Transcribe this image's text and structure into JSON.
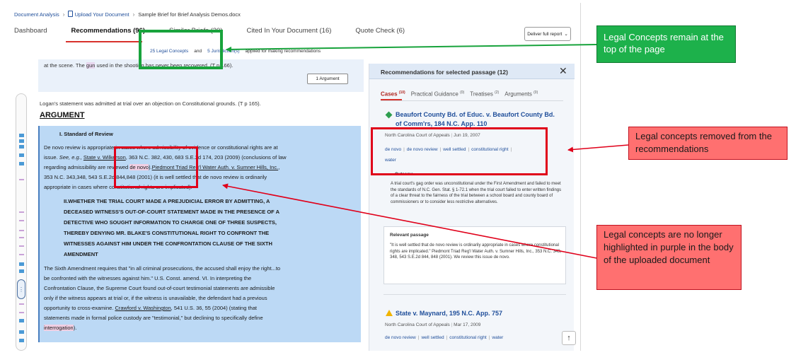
{
  "breadcrumb": {
    "item1": "Document Analysis",
    "item2": "Upload Your Document",
    "item3": "Sample Brief for Brief Analysis Demos.docx"
  },
  "tabs": [
    {
      "label": "Dashboard"
    },
    {
      "label": "Recommendations  (96)"
    },
    {
      "label": "Similar Briefs  (20)"
    },
    {
      "label": "Cited In Your Document  (16)"
    },
    {
      "label": "Quote Check  (6)"
    }
  ],
  "toolbar": {
    "deliver_label": "Deliver full report"
  },
  "applied": {
    "concepts_link": "25 Legal Concepts",
    "and": "and",
    "jurisdictions_link": "5 Jurisdiction(s)",
    "suffix": "applied for making recommendations"
  },
  "document": {
    "preview_line_a": "at the scene. The ",
    "preview_hl": "gun",
    "preview_line_b": " used in the shooting has never been recovered. (T p 166).",
    "argument_button": "1 Argument",
    "statement_line": "Logan's statement was admitted at trial over an objection on Constitutional grounds. (T p 165).",
    "argument_heading": "ARGUMENT",
    "standard_heading": "I. Standard of Review",
    "p1_l1": "De novo review is appropriate in cases where admissibility of evidence or constitutional rights are at",
    "p1_l2a": "issue. ",
    "p1_l2b": "See, e.g.,",
    "p1_l2c": "State v. Wilkerson",
    "p1_l2d": ", 363 N.C. 382, 430, 683 S.E.2d 174, 203 (2009) (conclusions of law",
    "p1_l3a": "regarding admissibility are reviewed ",
    "p1_l3b": "de novo",
    "p1_l3c": ").",
    "p1_l3d": "Piedmont Triad Reg'l Water Auth. v. Sumner Hills, Inc.",
    "p1_l3e": ",",
    "p1_l4": "353 N.C. 343,348, 543 S.E.2d 844,848 (2001) (it is well settled that de novo review is ordinarily",
    "p1_l5": "appropriate in cases where constitutional rights are implicated).",
    "h2_l1": "II.WHETHER THE TRIAL COURT MADE A PREJUDICIAL ERROR BY ADMITTING, A",
    "h2_l2": "DECEASED WITNESS'S OUT-OF-COURT STATEMENT MADE IN THE PRESENCE OF A",
    "h2_l3": "DETECTIVE WHO SOUGHT INFORMATION TO CHARGE ONE OF THREE SUSPECTS,",
    "h2_l4": "THEREBY DENYING MR. BLAKE'S CONSTITUTIONAL RIGHT TO CONFRONT THE",
    "h2_l5": "WITNESSES AGAINST HIM UNDER THE CONFRONTATION CLAUSE OF THE SIXTH",
    "h2_l6": "AMENDMENT",
    "p2_l1": "The Sixth Amendment requires that \"in all criminal prosecutions, the accused shall enjoy the right...to",
    "p2_l2": "be confronted with the witnesses against him.\" U.S. Const. amend. VI. In interpreting the",
    "p2_l3": "Confrontation Clause, the Supreme Court found out-of-court testimonial statements are admissible",
    "p2_l4": "only if the witness appears at trial or, if the witness is unavailable, the defendant had a previous",
    "p2_l5a": "opportunity to cross-examine. ",
    "p2_l5b": "Crawford v. Washington",
    "p2_l5c": ", 541 U.S. 36, 55 (2004) (stating that",
    "p2_l6": "statements made in formal police custody are \"testimonial,\" but declining to specifically define",
    "p2_l7a": "interrogation",
    "p2_l7b": ")."
  },
  "panel": {
    "title": "Recommendations for selected passage (12)",
    "close": "✕",
    "tabs": [
      {
        "label": "Cases",
        "count": "(10)"
      },
      {
        "label": "Practical Guidance",
        "count": "(0)"
      },
      {
        "label": "Treatises",
        "count": "(2)"
      },
      {
        "label": "Arguments",
        "count": "(0)"
      }
    ],
    "case1": {
      "title_l1": "Beaufort County Bd. of Educ. v. Beaufort County Bd.",
      "title_l2": "of Comm'rs, 184 N.C. App. 110",
      "court": "North Carolina Court of Appeals",
      "date": "Jun 19, 2007",
      "tags_row1": [
        "de novo",
        "de novo review",
        "well settled",
        "constitutional right"
      ],
      "tags_row2": [
        "water"
      ],
      "outcome_label": "Outcome",
      "outcome": "A trial court's gag order was unconstitutional under the First Amendment and failed to meet the standards of N.C. Gen. Stat. § 1-72.1 when the trial court failed to enter written findings of a clear threat to the fairness of the trial between a school board and county board of commissioners or to consider less restrictive alternatives.",
      "relevant_label": "Relevant passage",
      "relevant": "\"It is well settled that de novo review is ordinarily appropriate in cases where constitutional rights are implicated.\" Piedmont Triad Reg'l Water Auth. v. Sumner Hills, Inc., 353 N.C. 343, 348, 543 S.E.2d 844, 848 (2001). We review this issue de novo."
    },
    "case2": {
      "title": "State v. Maynard, 195 N.C. App. 757",
      "court": "North Carolina Court of Appeals",
      "date": "Mar 17, 2009",
      "tags": [
        "de novo review",
        "well settled",
        "constitutional right",
        "water"
      ]
    }
  },
  "annotations": {
    "green_note": "Legal Concepts remain at the top of the page",
    "red_note1": "Legal concepts removed from the recommendations",
    "red_note2": "Legal concepts are no longer highlighted in purple in the body of the uploaded document"
  },
  "colors": {
    "annotation_green": "#1db14b",
    "annotation_red": "#ff7070",
    "link_blue": "#1f4e9a",
    "active_red": "#d8322c",
    "selection_blue": "#bcd9f5"
  }
}
